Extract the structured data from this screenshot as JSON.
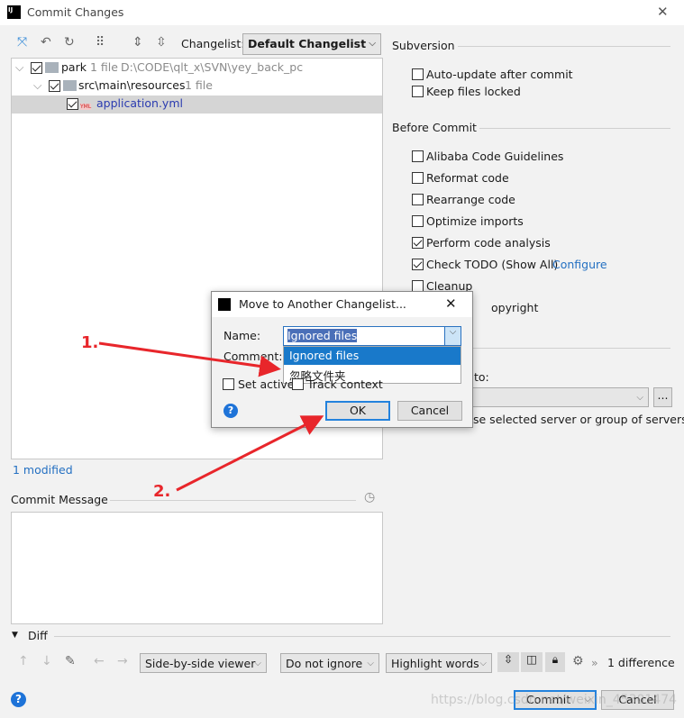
{
  "window": {
    "title": "Commit Changes",
    "close": "✕"
  },
  "toolbar": {
    "changelist_label": "Changelist:",
    "changelist_value": "Default Changelist"
  },
  "tree": {
    "rows": [
      {
        "name": "park",
        "info": "1 file",
        "path": "D:\\CODE\\qlt_x\\SVN\\yey_back_pc"
      },
      {
        "name": "src\\main\\resources",
        "info": "1 file"
      },
      {
        "name": "application.yml",
        "badge": "YML"
      }
    ],
    "status": "1 modified"
  },
  "commit_message": {
    "label": "Commit Message",
    "value": ""
  },
  "subversion": {
    "title": "Subversion",
    "options": [
      {
        "label": "Auto-update after commit",
        "checked": false
      },
      {
        "label": "Keep files locked",
        "checked": false
      }
    ]
  },
  "before_commit": {
    "title": "Before Commit",
    "options": [
      {
        "label": "Alibaba Code Guidelines",
        "checked": false
      },
      {
        "label": "Reformat code",
        "checked": false
      },
      {
        "label": "Rearrange code",
        "checked": false
      },
      {
        "label": "Optimize imports",
        "checked": false
      },
      {
        "label": "Perform code analysis",
        "checked": true
      },
      {
        "label": "Check TODO (Show All)",
        "checked": true,
        "link": "Configure"
      },
      {
        "label": "Cleanup",
        "checked": false
      },
      {
        "label": "opyright",
        "checked": false
      }
    ]
  },
  "commit_to": {
    "label_fragment": "to:",
    "more": "...",
    "hint_fragment": "se selected server or group of servers"
  },
  "diff": {
    "title": "Diff",
    "viewer": "Side-by-side viewer",
    "ignore": "Do not ignore",
    "highlight": "Highlight words",
    "count": "1 difference"
  },
  "footer": {
    "commit": "Commit",
    "cancel": "Cancel",
    "watermark": "https://blog.csdn.net/weixin_45301474"
  },
  "dialog": {
    "title": "Move to Another Changelist...",
    "name_label": "Name:",
    "name_value": "Ignored files",
    "comment_label": "Comment:",
    "options": [
      "Ignored files",
      "忽略文件夹"
    ],
    "set_active": "Set active",
    "track_context": "Track context",
    "ok": "OK",
    "cancel": "Cancel"
  },
  "annotations": {
    "step1": "1.",
    "step2": "2.",
    "color": "#e8262b"
  }
}
